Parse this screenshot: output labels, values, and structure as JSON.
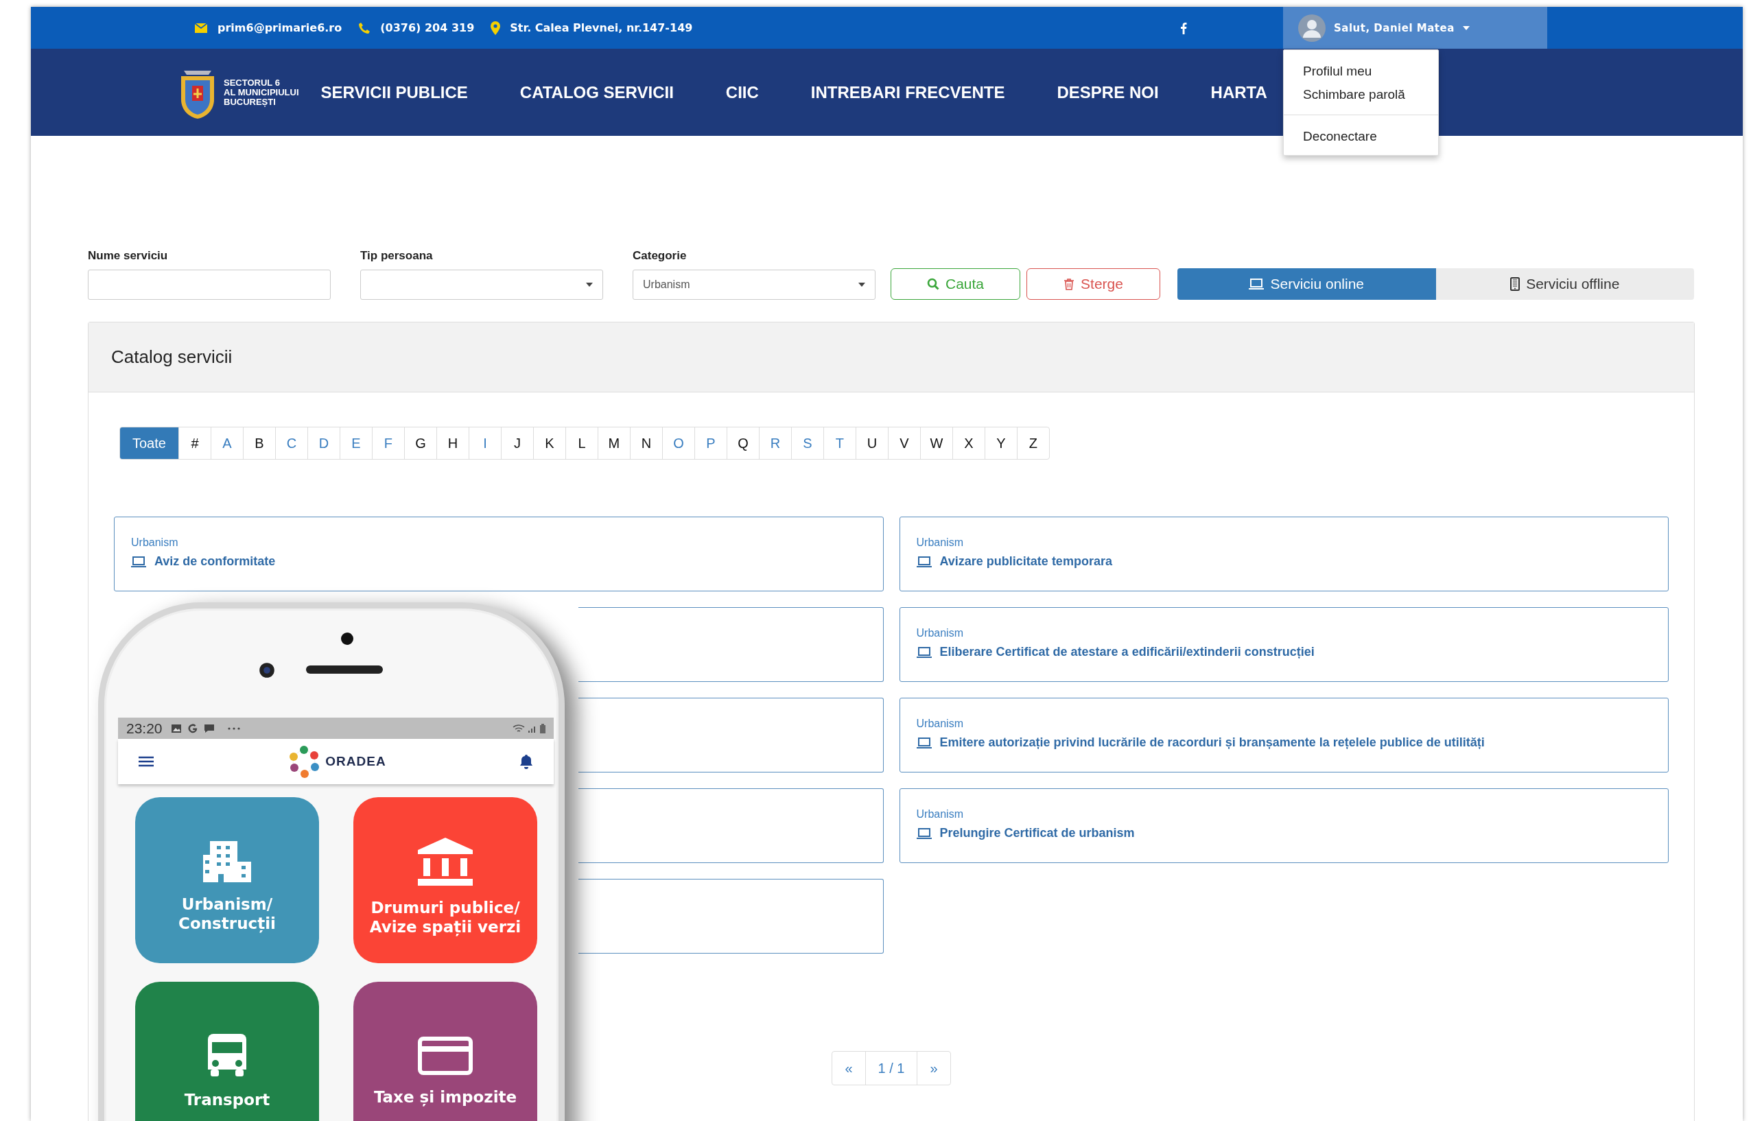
{
  "top_bar": {
    "email": "prim6@primarie6.ro",
    "phone": "(0376) 204 319",
    "address": "Str. Calea Plevnei, nr.147-149",
    "user_greeting": "Salut, Daniel Matea"
  },
  "logo": {
    "lines": [
      "SECTORUL 6",
      "AL MUNICIPIULUI",
      "BUCUREȘTI"
    ]
  },
  "nav": [
    "SERVICII PUBLICE",
    "CATALOG SERVICII",
    "CIIC",
    "INTREBARI FRECVENTE",
    "DESPRE NOI",
    "HARTA"
  ],
  "user_menu": [
    {
      "kind": "item",
      "label": "Profilul meu"
    },
    {
      "kind": "item",
      "label": "Schimbare parolă"
    },
    {
      "kind": "divider"
    },
    {
      "kind": "item",
      "label": "Deconectare"
    }
  ],
  "filters": [
    {
      "kind": "text",
      "label": "Nume serviciu"
    },
    {
      "kind": "select",
      "label": "Tip persoana"
    },
    {
      "kind": "select",
      "label": "Categorie",
      "value": "Urbanism"
    }
  ],
  "buttons": [
    {
      "kind": "search",
      "label": "Cauta"
    },
    {
      "kind": "delete",
      "label": "Sterge"
    }
  ],
  "mode_toggle": [
    {
      "kind": "laptop",
      "label": "Serviciu online",
      "selected": true
    },
    {
      "kind": "tablet",
      "label": "Serviciu offline",
      "selected": false
    }
  ],
  "catalog": {
    "title": "Catalog servicii",
    "letters": [
      {
        "label": "Toate",
        "selected": true,
        "enabled": true
      },
      {
        "label": "#",
        "selected": false,
        "enabled": false
      },
      {
        "label": "A",
        "selected": false,
        "enabled": true
      },
      {
        "label": "B",
        "selected": false,
        "enabled": false
      },
      {
        "label": "C",
        "selected": false,
        "enabled": true
      },
      {
        "label": "D",
        "selected": false,
        "enabled": true
      },
      {
        "label": "E",
        "selected": false,
        "enabled": true
      },
      {
        "label": "F",
        "selected": false,
        "enabled": true
      },
      {
        "label": "G",
        "selected": false,
        "enabled": false
      },
      {
        "label": "H",
        "selected": false,
        "enabled": false
      },
      {
        "label": "I",
        "selected": false,
        "enabled": true
      },
      {
        "label": "J",
        "selected": false,
        "enabled": false
      },
      {
        "label": "K",
        "selected": false,
        "enabled": false
      },
      {
        "label": "L",
        "selected": false,
        "enabled": false
      },
      {
        "label": "M",
        "selected": false,
        "enabled": false
      },
      {
        "label": "N",
        "selected": false,
        "enabled": false
      },
      {
        "label": "O",
        "selected": false,
        "enabled": true
      },
      {
        "label": "P",
        "selected": false,
        "enabled": true
      },
      {
        "label": "Q",
        "selected": false,
        "enabled": false
      },
      {
        "label": "R",
        "selected": false,
        "enabled": true
      },
      {
        "label": "S",
        "selected": false,
        "enabled": true
      },
      {
        "label": "T",
        "selected": false,
        "enabled": true
      },
      {
        "label": "U",
        "selected": false,
        "enabled": false
      },
      {
        "label": "V",
        "selected": false,
        "enabled": false
      },
      {
        "label": "W",
        "selected": false,
        "enabled": false
      },
      {
        "label": "X",
        "selected": false,
        "enabled": false
      },
      {
        "label": "Y",
        "selected": false,
        "enabled": false
      },
      {
        "label": "Z",
        "selected": false,
        "enabled": false
      }
    ],
    "cards": [
      {
        "kind": "service",
        "category": "Urbanism",
        "title": "Aviz de conformitate"
      },
      {
        "kind": "service",
        "category": "Urbanism",
        "title": "Avizare publicitate temporara"
      },
      {
        "kind": "covered"
      },
      {
        "kind": "service",
        "category": "Urbanism",
        "title": "Eliberare Certificat de atestare a edificării/extinderii construcției"
      },
      {
        "kind": "covered"
      },
      {
        "kind": "service",
        "category": "Urbanism",
        "title": "Emitere autorizație privind lucrările de racorduri și branșamente la rețelele publice de utilități"
      },
      {
        "kind": "covered"
      },
      {
        "kind": "service",
        "category": "Urbanism",
        "title": "Prelungire Certificat de urbanism"
      },
      {
        "kind": "covered"
      }
    ],
    "pagination": {
      "prev": "«",
      "page": "1 / 1",
      "next": "»"
    }
  },
  "phone": {
    "time": "23:20",
    "brand": "ORADEA",
    "tiles": [
      {
        "kind": "buildings",
        "label": "Urbanism/\nConstrucții",
        "color": "#4195b6"
      },
      {
        "kind": "bank",
        "label": "Drumuri publice/\nAvize spații verzi",
        "color": "#fb4436"
      },
      {
        "kind": "bus",
        "label": "Transport",
        "color": "#20834a"
      },
      {
        "kind": "card",
        "label": "Taxe și impozite",
        "color": "#9a4679"
      }
    ]
  }
}
